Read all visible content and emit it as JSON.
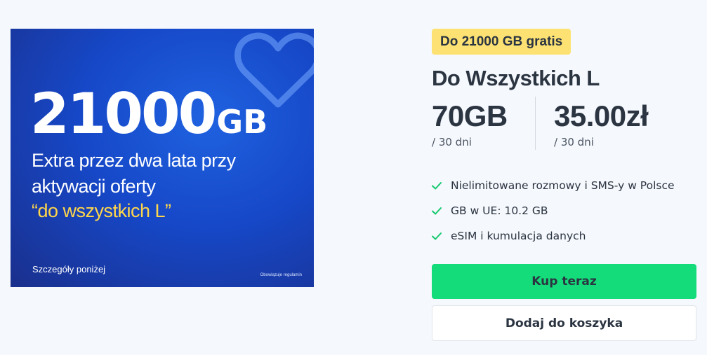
{
  "banner": {
    "headline_number": "21000",
    "headline_unit": "GB",
    "line1": "Extra przez dwa lata przy",
    "line2": "aktywacji oferty",
    "line3": "“do wszystkich L”",
    "details": "Szczegóły poniżej",
    "terms": "Obowiązuje regulamin",
    "icon": "heart-outline-icon"
  },
  "offer": {
    "badge": "Do 21000 GB gratis",
    "title": "Do Wszystkich L",
    "data_value": "70GB",
    "data_period": "/ 30 dni",
    "price_value": "35.00zł",
    "price_period": "/ 30 dni",
    "features": [
      "Nielimitowane rozmowy i SMS-y w Polsce",
      "GB w UE: 10.2 GB",
      "eSIM i kumulacja danych"
    ],
    "buy_label": "Kup teraz",
    "cart_label": "Dodaj do koszyka"
  },
  "colors": {
    "accent_green": "#14dc7a",
    "badge_yellow": "#fde273",
    "banner_blue": "#1648c8",
    "highlight_yellow": "#ffd64a",
    "check_green": "#14c96e"
  }
}
